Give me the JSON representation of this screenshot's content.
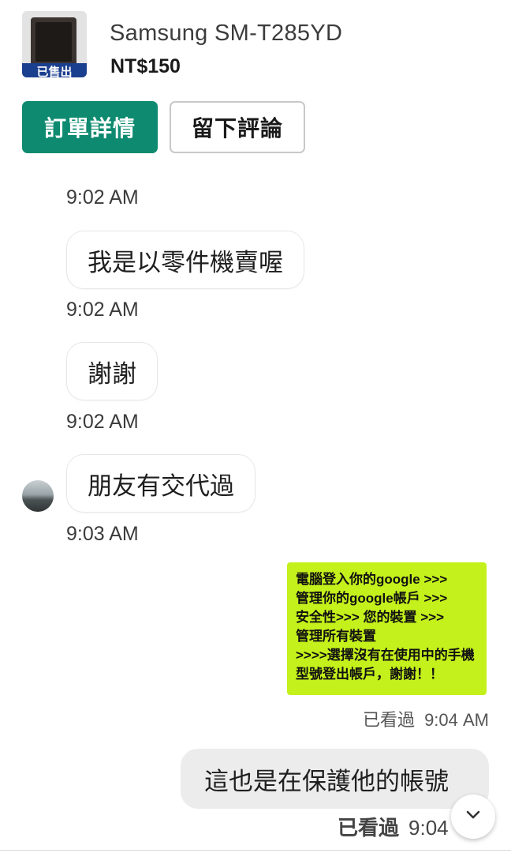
{
  "product": {
    "name": "Samsung SM-T285YD",
    "price": "NT$150",
    "sold_badge": "已售出"
  },
  "actions": {
    "order_details": "訂單詳情",
    "leave_review": "留下評論"
  },
  "messages": [
    {
      "time": "9:02 AM"
    },
    {
      "text": "我是以零件機賣喔",
      "time": "9:02 AM"
    },
    {
      "text": "謝謝",
      "time": "9:02 AM"
    },
    {
      "text": "朋友有交代過",
      "time": "9:03 AM"
    }
  ],
  "image_message": {
    "lines": [
      "電腦登入你的google >>>",
      "管理你的google帳戶 >>>",
      "安全性>>> 您的裝置  >>>",
      "管理所有裝置",
      ">>>>選擇沒有在使用中的手機",
      "型號登出帳戶，謝謝！！"
    ],
    "background": "#c4f01b",
    "seen": "已看過",
    "time": "9:04 AM"
  },
  "outgoing": {
    "text": "這也是在保護他的帳號",
    "seen": "已看過",
    "time": "9:04"
  },
  "colors": {
    "accent": "#0d8a6f",
    "sold_badge": "#1b3f8f"
  },
  "icons": {
    "scroll_down": "chevron-down-icon"
  }
}
